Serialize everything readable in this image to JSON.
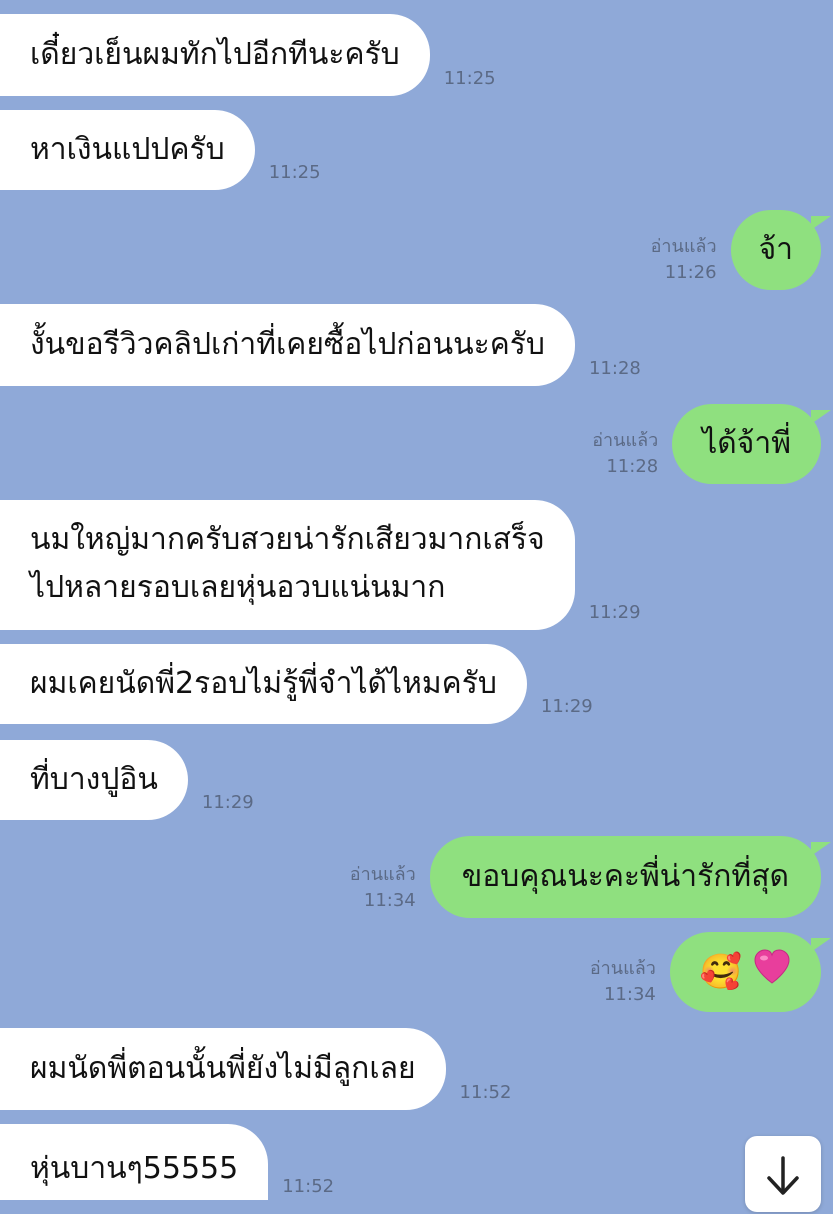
{
  "colors": {
    "background": "#8fa9d8",
    "incoming_bubble": "#ffffff",
    "outgoing_bubble": "#8fe07f",
    "meta_text": "#5b6a86"
  },
  "messages": [
    {
      "side": "in",
      "text": "เดี๋ยวเย็นผมทักไปอีกทีนะครับ",
      "time": "11:25"
    },
    {
      "side": "in",
      "text": "หาเงินแปปครับ",
      "time": "11:25"
    },
    {
      "side": "out",
      "text": "จ้า",
      "time": "11:26",
      "read": "อ่านแล้ว"
    },
    {
      "side": "in",
      "text": "งั้นขอรีวิวคลิปเก่าที่เคยซื้อไปก่อนนะครับ",
      "time": "11:28"
    },
    {
      "side": "out",
      "text": "ได้จ้าพี่",
      "time": "11:28",
      "read": "อ่านแล้ว"
    },
    {
      "side": "in",
      "text": "นมใหญ่มากครับสวยน่ารักเสียวมากเสร็จ",
      "text2": "ไปหลายรอบเลยหุ่นอวบแน่นมาก",
      "time": "11:29"
    },
    {
      "side": "in",
      "text": "ผมเคยนัดพี่2รอบไม่รู้พี่จำได้ไหมครับ",
      "time": "11:29"
    },
    {
      "side": "in",
      "text": "ที่บางปูอิน",
      "time": "11:29"
    },
    {
      "side": "out",
      "text": "ขอบคุณนะคะพี่น่ารักที่สุด",
      "time": "11:34",
      "read": "อ่านแล้ว"
    },
    {
      "side": "out",
      "text": "🥰",
      "time": "11:34",
      "read": "อ่านแล้ว",
      "emoji": true,
      "icon": "heart-icon"
    },
    {
      "side": "in",
      "text": "ผมนัดพี่ตอนนั้นพี่ยังไม่มีลูกเลย",
      "time": "11:52"
    },
    {
      "side": "in",
      "text": "หุ่นบานๆ55555",
      "time": "11:52"
    }
  ],
  "scroll_button": {
    "icon": "arrow-down-icon"
  }
}
